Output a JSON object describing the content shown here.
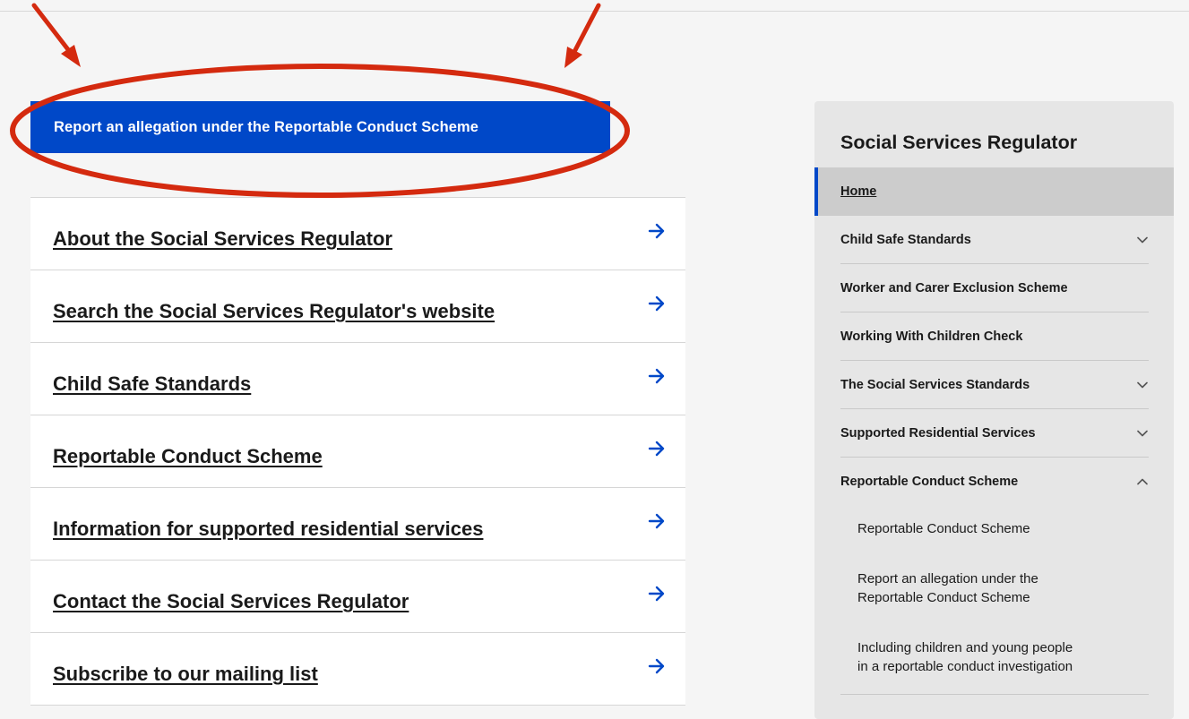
{
  "cta": {
    "label": "Report an allegation under the Reportable Conduct Scheme"
  },
  "links": [
    {
      "label": "About the Social Services Regulator"
    },
    {
      "label": "Search the Social Services Regulator's website"
    },
    {
      "label": "Child Safe Standards"
    },
    {
      "label": "Reportable Conduct Scheme"
    },
    {
      "label": "Information for supported residential services"
    },
    {
      "label": "Contact the Social Services Regulator"
    },
    {
      "label": "Subscribe to our mailing list"
    }
  ],
  "sidebar": {
    "title": "Social Services Regulator",
    "home": {
      "label": "Home"
    },
    "items": [
      {
        "label": "Child Safe Standards",
        "icon": "chevron-down-icon"
      },
      {
        "label": "Worker and Carer Exclusion Scheme"
      },
      {
        "label": "Working With Children Check"
      },
      {
        "label": "The Social Services Standards",
        "icon": "chevron-down-icon"
      },
      {
        "label": "Supported Residential Services",
        "icon": "chevron-down-icon"
      },
      {
        "label": "Reportable Conduct Scheme",
        "icon": "chevron-up-icon"
      }
    ],
    "subitems": [
      {
        "line1": "Reportable Conduct Scheme"
      },
      {
        "line1": "Report an allegation under the",
        "line2": "Reportable Conduct Scheme"
      },
      {
        "line1": "Including children and young people",
        "line2": "in a reportable conduct investigation"
      }
    ]
  },
  "colors": {
    "accent_blue": "#0048c8",
    "annotation_red": "#d42a0f",
    "sidebar_bg": "#e6e6e6",
    "active_item_bg": "#cccccc"
  }
}
